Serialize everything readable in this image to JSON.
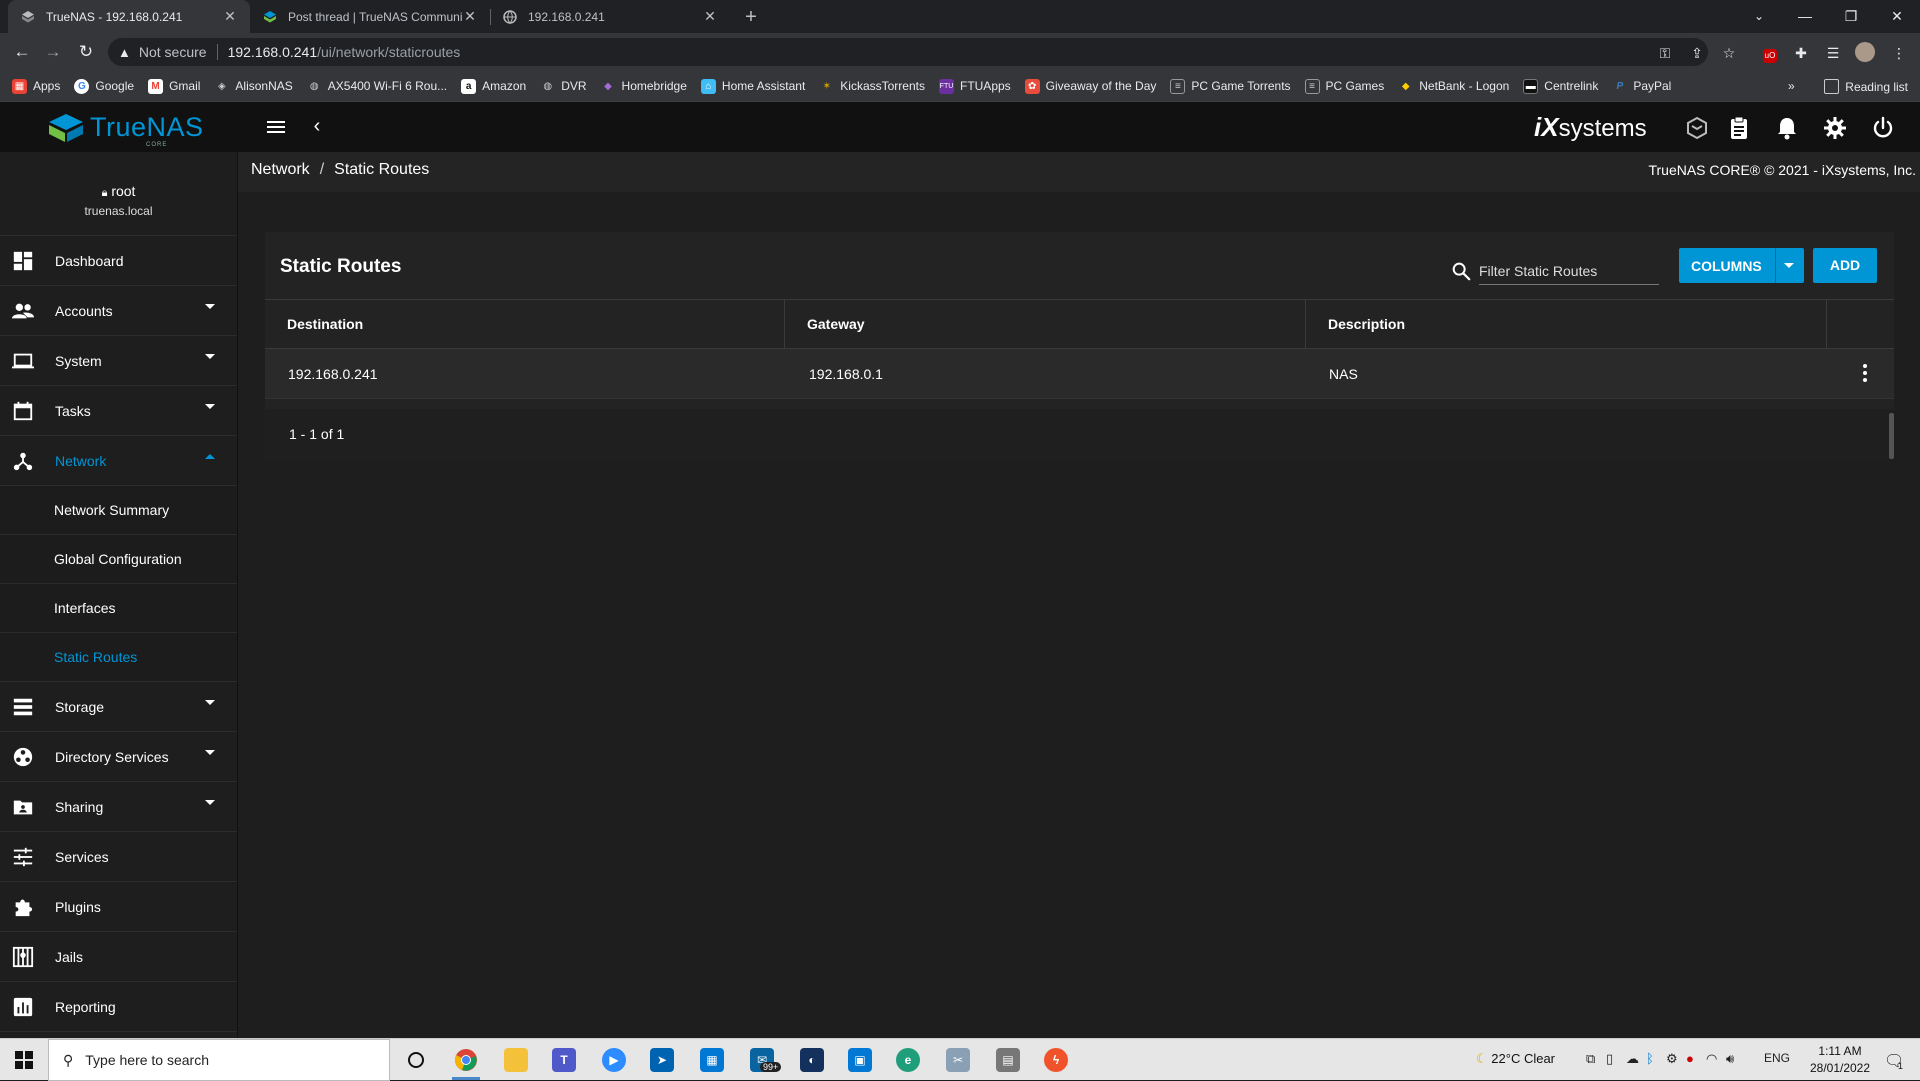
{
  "browser": {
    "tabs": [
      {
        "title": "TrueNAS - 192.168.0.241",
        "active": true
      },
      {
        "title": "Post thread | TrueNAS Communit",
        "active": false
      },
      {
        "title": "192.168.0.241",
        "active": false
      }
    ],
    "security_label": "Not secure",
    "url_host": "192.168.0.241",
    "url_path": "/ui/network/staticroutes",
    "bookmarks": [
      {
        "label": "Apps",
        "icon": "apps-grid-icon",
        "color": "#ea4335"
      },
      {
        "label": "Google",
        "icon": "google-icon",
        "color": "#4285f4"
      },
      {
        "label": "Gmail",
        "icon": "gmail-icon",
        "color": "#666666"
      },
      {
        "label": "AlisonNAS",
        "icon": "truenas-icon",
        "color": "#0095d5"
      },
      {
        "label": "AX5400 Wi-Fi 6 Rou...",
        "icon": "globe-icon",
        "color": "#555555"
      },
      {
        "label": "Amazon",
        "icon": "amazon-icon",
        "color": "#ffffff"
      },
      {
        "label": "DVR",
        "icon": "globe-icon",
        "color": "#555555"
      },
      {
        "label": "Homebridge",
        "icon": "homebridge-icon",
        "color": "#8e44ad"
      },
      {
        "label": "Home Assistant",
        "icon": "home-assistant-icon",
        "color": "#41bdf5"
      },
      {
        "label": "KickassTorrents",
        "icon": "kat-icon",
        "color": "#d6a400"
      },
      {
        "label": "FTUApps",
        "icon": "ftu-icon",
        "color": "#6b2fa0"
      },
      {
        "label": "Giveaway of the Day",
        "icon": "gotd-icon",
        "color": "#e74c3c"
      },
      {
        "label": "PC Game Torrents",
        "icon": "page-icon",
        "color": "#888888"
      },
      {
        "label": "PC Games",
        "icon": "page-icon",
        "color": "#888888"
      },
      {
        "label": "NetBank - Logon",
        "icon": "netbank-icon",
        "color": "#ffcc00"
      },
      {
        "label": "Centrelink",
        "icon": "centrelink-icon",
        "color": "#222222"
      },
      {
        "label": "PayPal",
        "icon": "paypal-icon",
        "color": "#3b7bbf"
      }
    ],
    "more_bookmarks": "»",
    "reading_list": "Reading list"
  },
  "app": {
    "brand": "TrueNAS",
    "brand_sub": "CORE",
    "vendor": "iX",
    "vendor_rest": "systems",
    "user": "root",
    "host": "truenas.local",
    "copyright": "TrueNAS CORE® © 2021 - iXsystems, Inc.",
    "accent": "#0095d5"
  },
  "sidebar": {
    "items": [
      {
        "label": "Dashboard"
      },
      {
        "label": "Accounts"
      },
      {
        "label": "System"
      },
      {
        "label": "Tasks"
      },
      {
        "label": "Network"
      },
      {
        "label": "Storage"
      },
      {
        "label": "Directory Services"
      },
      {
        "label": "Sharing"
      },
      {
        "label": "Services"
      },
      {
        "label": "Plugins"
      },
      {
        "label": "Jails"
      },
      {
        "label": "Reporting"
      }
    ],
    "network_sub": [
      {
        "label": "Network Summary"
      },
      {
        "label": "Global Configuration"
      },
      {
        "label": "Interfaces"
      },
      {
        "label": "Static Routes"
      }
    ]
  },
  "breadcrumb": {
    "parent": "Network",
    "current": "Static Routes",
    "separator": "/"
  },
  "card": {
    "title": "Static Routes",
    "filter_placeholder": "Filter Static Routes",
    "columns_label": "COLUMNS",
    "add_label": "ADD",
    "headers": [
      "Destination",
      "Gateway",
      "Description"
    ],
    "rows": [
      {
        "destination": "192.168.0.241",
        "gateway": "192.168.0.1",
        "description": "NAS"
      }
    ],
    "pager": "1 - 1 of 1"
  },
  "taskbar": {
    "search_placeholder": "Type here to search",
    "weather": "22°C  Clear",
    "lang": "ENG",
    "time": "1:11 AM",
    "date": "28/01/2022",
    "mail_badge": "99+",
    "notification_count": "1"
  }
}
